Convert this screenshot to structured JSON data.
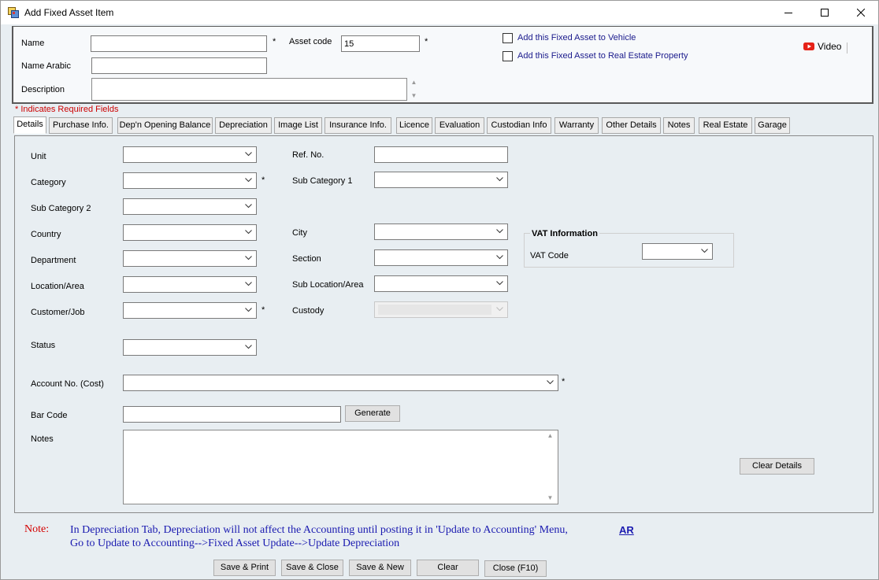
{
  "window": {
    "title": "Add Fixed Asset Item"
  },
  "header": {
    "name_label": "Name",
    "name_value": "",
    "name_arabic_label": "Name Arabic",
    "name_arabic_value": "",
    "description_label": "Description",
    "description_value": "",
    "asset_code_label": "Asset code",
    "asset_code_value": "15",
    "required_mark": "*",
    "checkbox_vehicle_label": "Add this Fixed Asset to Vehicle",
    "checkbox_vehicle_checked": false,
    "checkbox_real_estate_label": "Add this Fixed Asset to Real Estate Property",
    "checkbox_real_estate_checked": false,
    "video_label": "Video"
  },
  "required_note": "* Indicates Required Fields",
  "tabs": [
    {
      "label": "Details",
      "active": true
    },
    {
      "label": "Purchase Info."
    },
    {
      "label": "Dep'n Opening Balance"
    },
    {
      "label": "Depreciation"
    },
    {
      "label": "Image List"
    },
    {
      "label": "Insurance Info."
    },
    {
      "label": "Licence"
    },
    {
      "label": "Evaluation"
    },
    {
      "label": "Custodian Info"
    },
    {
      "label": "Warranty"
    },
    {
      "label": "Other Details"
    },
    {
      "label": "Notes"
    },
    {
      "label": "Real Estate"
    },
    {
      "label": "Garage"
    }
  ],
  "details": {
    "unit_label": "Unit",
    "category_label": "Category",
    "sub_category_2_label": "Sub Category 2",
    "country_label": "Country",
    "department_label": "Department",
    "location_label": "Location/Area",
    "customer_job_label": "Customer/Job",
    "status_label": "Status",
    "ref_no_label": "Ref. No.",
    "sub_category_1_label": "Sub Category 1",
    "city_label": "City",
    "section_label": "Section",
    "sub_location_label": "Sub Location/Area",
    "custody_label": "Custody",
    "vat_group_title": "VAT Information",
    "vat_code_label": "VAT Code",
    "account_no_label": "Account No. (Cost)",
    "bar_code_label": "Bar Code",
    "generate_button": "Generate",
    "notes_label": "Notes",
    "clear_details_button": "Clear Details"
  },
  "note": {
    "label": "Note:",
    "line1": "In Depreciation Tab, Depreciation will not affect the Accounting until posting it in 'Update to Accounting' Menu,",
    "line2": "Go to Update to Accounting-->Fixed Asset Update-->Update Depreciation",
    "ar_link": "AR"
  },
  "buttons": {
    "save_print": "Save & Print",
    "save_close": "Save & Close",
    "save_new": "Save & New",
    "clear": "Clear",
    "close": "Close (F10)"
  },
  "colors": {
    "required_red": "#cc0000",
    "link_blue": "#1a1a8c",
    "note_blue": "#1a1ab0",
    "video_red": "#e62117"
  }
}
